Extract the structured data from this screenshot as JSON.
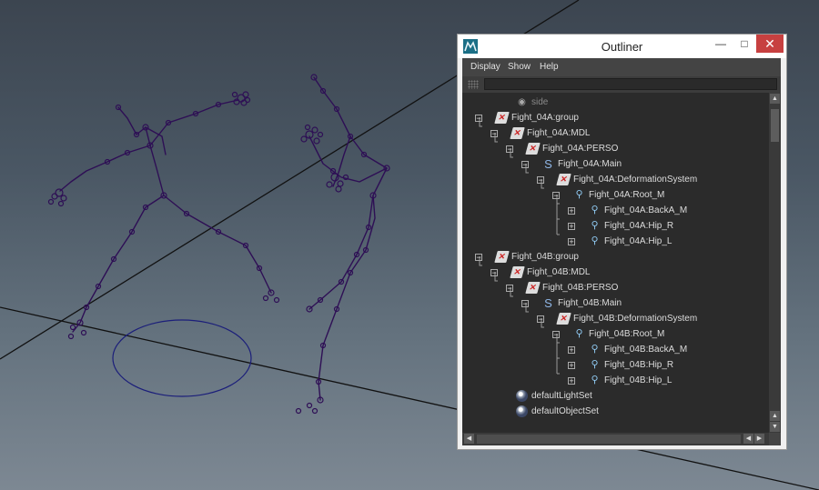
{
  "window": {
    "title": "Outliner",
    "minimize_glyph": "—",
    "maximize_glyph": "□",
    "close_glyph": "✕"
  },
  "menu": [
    "Display",
    "Show",
    "Help"
  ],
  "filter": {
    "value": ""
  },
  "tree": [
    {
      "label": "side",
      "icon": "camera-icon",
      "glyph": "◉",
      "expander": "",
      "dim": true
    },
    {
      "label": "Fight_04A:group",
      "icon": "transform-icon",
      "glyph": "✕",
      "expander": "−"
    },
    {
      "label": "Fight_04A:MDL",
      "icon": "transform-icon",
      "glyph": "✕",
      "expander": "−"
    },
    {
      "label": "Fight_04A:PERSO",
      "icon": "transform-icon",
      "glyph": "✕",
      "expander": "−"
    },
    {
      "label": "Fight_04A:Main",
      "icon": "curve-icon",
      "glyph": "S",
      "expander": "−"
    },
    {
      "label": "Fight_04A:DeformationSystem",
      "icon": "transform-icon",
      "glyph": "✕",
      "expander": "−"
    },
    {
      "label": "Fight_04A:Root_M",
      "icon": "joint-icon",
      "glyph": "⚲",
      "expander": "−"
    },
    {
      "label": "Fight_04A:BackA_M",
      "icon": "joint-icon",
      "glyph": "⚲",
      "expander": "+"
    },
    {
      "label": "Fight_04A:Hip_R",
      "icon": "joint-icon",
      "glyph": "⚲",
      "expander": "+"
    },
    {
      "label": "Fight_04A:Hip_L",
      "icon": "joint-icon",
      "glyph": "⚲",
      "expander": "+"
    },
    {
      "label": "Fight_04B:group",
      "icon": "transform-icon",
      "glyph": "✕",
      "expander": "−"
    },
    {
      "label": "Fight_04B:MDL",
      "icon": "transform-icon",
      "glyph": "✕",
      "expander": "−"
    },
    {
      "label": "Fight_04B:PERSO",
      "icon": "transform-icon",
      "glyph": "✕",
      "expander": "−"
    },
    {
      "label": "Fight_04B:Main",
      "icon": "curve-icon",
      "glyph": "S",
      "expander": "−"
    },
    {
      "label": "Fight_04B:DeformationSystem",
      "icon": "transform-icon",
      "glyph": "✕",
      "expander": "−"
    },
    {
      "label": "Fight_04B:Root_M",
      "icon": "joint-icon",
      "glyph": "⚲",
      "expander": "−"
    },
    {
      "label": "Fight_04B:BackA_M",
      "icon": "joint-icon",
      "glyph": "⚲",
      "expander": "+"
    },
    {
      "label": "Fight_04B:Hip_R",
      "icon": "joint-icon",
      "glyph": "⚲",
      "expander": "+"
    },
    {
      "label": "Fight_04B:Hip_L",
      "icon": "joint-icon",
      "glyph": "⚲",
      "expander": "+"
    },
    {
      "label": "defaultLightSet",
      "icon": "set-icon",
      "glyph": "",
      "expander": ""
    },
    {
      "label": "defaultObjectSet",
      "icon": "set-icon",
      "glyph": "",
      "expander": ""
    }
  ],
  "scrollbars": {
    "up": "▲",
    "down": "▼",
    "left": "◀",
    "right": "▶"
  },
  "colors": {
    "rig": "#2e0f55",
    "viewport_top": "#3c4550",
    "viewport_bottom": "#7d8893",
    "panel": "#444444",
    "tree_bg": "#2b2b2b",
    "close_button": "#c74040"
  }
}
